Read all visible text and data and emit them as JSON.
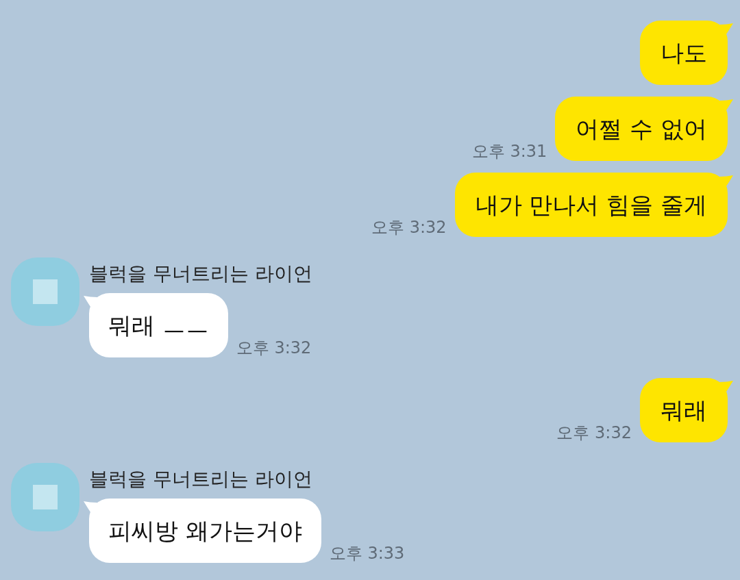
{
  "messages": [
    {
      "kind": "sent",
      "text": "나도"
    },
    {
      "kind": "sent",
      "text": "어쩔 수 없어",
      "time": "오후 3:31"
    },
    {
      "kind": "sent",
      "text": "내가 만나서 힘을 줄게",
      "time": "오후 3:32"
    },
    {
      "kind": "received",
      "sender": "블럭을 무너트리는 라이언",
      "text": "뭐래 ㅡㅡ",
      "time": "오후 3:32"
    },
    {
      "kind": "sent",
      "text": "뭐래",
      "time": "오후 3:32"
    },
    {
      "kind": "received",
      "sender": "블럭을 무너트리는 라이언",
      "text": "피씨방 왜가는거야",
      "time": "오후 3:33"
    }
  ]
}
